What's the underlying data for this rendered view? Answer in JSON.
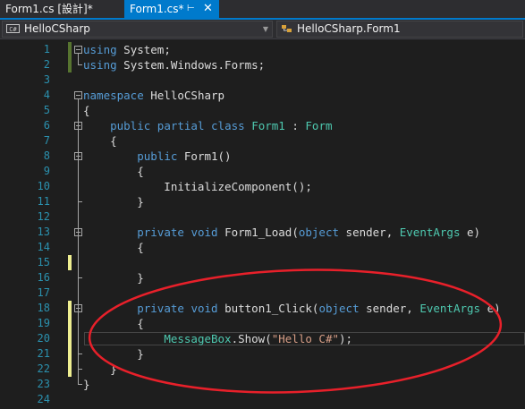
{
  "tabs": [
    {
      "label": "Form1.cs [設計]*",
      "active": false
    },
    {
      "label": "Form1.cs*",
      "active": true,
      "pin_icon": "pin-icon",
      "close_icon": "close-icon"
    }
  ],
  "navbar": {
    "left": {
      "badge": "C#",
      "label": "HelloCSharp"
    },
    "right": {
      "label": "HelloCSharp.Form1",
      "icon": "class-icon"
    }
  },
  "editor": {
    "lines": [
      {
        "n": "1",
        "tokens": [
          [
            "kw",
            "using"
          ],
          [
            "",
            "System;"
          ]
        ]
      },
      {
        "n": "2",
        "tokens": [
          [
            "kw",
            "using"
          ],
          [
            "",
            "System.Windows.Forms;"
          ]
        ]
      },
      {
        "n": "3",
        "tokens": []
      },
      {
        "n": "4",
        "tokens": [
          [
            "kw",
            "namespace"
          ],
          [
            "",
            "HelloCSharp"
          ]
        ]
      },
      {
        "n": "5",
        "tokens": [
          [
            "",
            "{"
          ]
        ]
      },
      {
        "n": "6",
        "tokens": [
          [
            "",
            "    "
          ],
          [
            "kw",
            "public"
          ],
          [
            "",
            " "
          ],
          [
            "kw",
            "partial"
          ],
          [
            "",
            " "
          ],
          [
            "kw",
            "class"
          ],
          [
            "",
            " "
          ],
          [
            "ty",
            "Form1"
          ],
          [
            "",
            " : "
          ],
          [
            "ty",
            "Form"
          ]
        ]
      },
      {
        "n": "7",
        "tokens": [
          [
            "",
            "    {"
          ]
        ]
      },
      {
        "n": "8",
        "tokens": [
          [
            "",
            "        "
          ],
          [
            "kw",
            "public"
          ],
          [
            "",
            " Form1()"
          ]
        ]
      },
      {
        "n": "9",
        "tokens": [
          [
            "",
            "        {"
          ]
        ]
      },
      {
        "n": "10",
        "tokens": [
          [
            "",
            "            InitializeComponent();"
          ]
        ]
      },
      {
        "n": "11",
        "tokens": [
          [
            "",
            "        }"
          ]
        ]
      },
      {
        "n": "12",
        "tokens": []
      },
      {
        "n": "13",
        "tokens": [
          [
            "",
            "        "
          ],
          [
            "kw",
            "private"
          ],
          [
            "",
            " "
          ],
          [
            "kw",
            "void"
          ],
          [
            "",
            " Form1_Load("
          ],
          [
            "kw",
            "object"
          ],
          [
            "",
            " sender, "
          ],
          [
            "ty",
            "EventArgs"
          ],
          [
            "",
            " e)"
          ]
        ]
      },
      {
        "n": "14",
        "tokens": [
          [
            "",
            "        {"
          ]
        ]
      },
      {
        "n": "15",
        "tokens": []
      },
      {
        "n": "16",
        "tokens": [
          [
            "",
            "        }"
          ]
        ]
      },
      {
        "n": "17",
        "tokens": []
      },
      {
        "n": "18",
        "tokens": [
          [
            "",
            "        "
          ],
          [
            "kw",
            "private"
          ],
          [
            "",
            " "
          ],
          [
            "kw",
            "void"
          ],
          [
            "",
            " button1_Click("
          ],
          [
            "kw",
            "object"
          ],
          [
            "",
            " sender, "
          ],
          [
            "ty",
            "EventArgs"
          ],
          [
            "",
            " e)"
          ]
        ]
      },
      {
        "n": "19",
        "tokens": [
          [
            "",
            "        {"
          ]
        ]
      },
      {
        "n": "20",
        "tokens": [
          [
            "",
            "            "
          ],
          [
            "ty",
            "MessageBox"
          ],
          [
            "",
            ".Show("
          ],
          [
            "st",
            "\"Hello C#\""
          ],
          [
            "",
            ");"
          ]
        ]
      },
      {
        "n": "21",
        "tokens": [
          [
            "",
            "        }"
          ]
        ]
      },
      {
        "n": "22",
        "tokens": [
          [
            "",
            "    }"
          ]
        ]
      },
      {
        "n": "23",
        "tokens": [
          [
            "",
            "}"
          ]
        ]
      },
      {
        "n": "24",
        "tokens": []
      }
    ],
    "current_line": "20"
  },
  "colors": {
    "accent": "#007acc",
    "keyword": "#569cd6",
    "type": "#4ec9b0",
    "string": "#d69d85",
    "annotation": "#e8202a"
  }
}
